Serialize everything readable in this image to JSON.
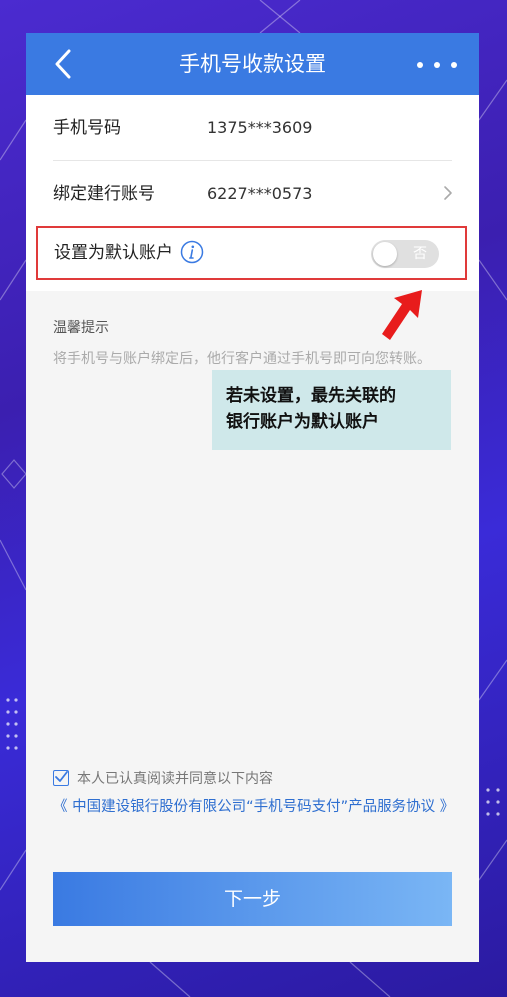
{
  "header": {
    "title": "手机号收款设置"
  },
  "rows": [
    {
      "label": "手机号码",
      "value": "1375***3609"
    },
    {
      "label": "绑定建行账号",
      "value": "6227***0573"
    }
  ],
  "default_setting": {
    "label": "设置为默认账户",
    "toggle_text": "否",
    "enabled": false
  },
  "tips": {
    "title": "温馨提示",
    "text": "将手机号与账户绑定后，他行客户通过手机号即可向您转账。"
  },
  "callout": {
    "line1": "若未设置，最先关联的",
    "line2": "银行账户为默认账户"
  },
  "agreement": {
    "checkbox_text": "本人已认真阅读并同意以下内容",
    "link_text": "《 中国建设银行股份有限公司“手机号码支付”产品服务协议 》",
    "checked": true
  },
  "next_button": {
    "label": "下一步"
  },
  "colors": {
    "brand": "#3a7ae2",
    "highlight_border": "#e03a3a",
    "arrow": "#e81c1c",
    "callout_bg": "#cfe8ea"
  },
  "icons": [
    "chevron-left-icon",
    "more-dots-icon",
    "chevron-right-icon",
    "info-icon",
    "check-icon",
    "red-arrow-icon"
  ]
}
